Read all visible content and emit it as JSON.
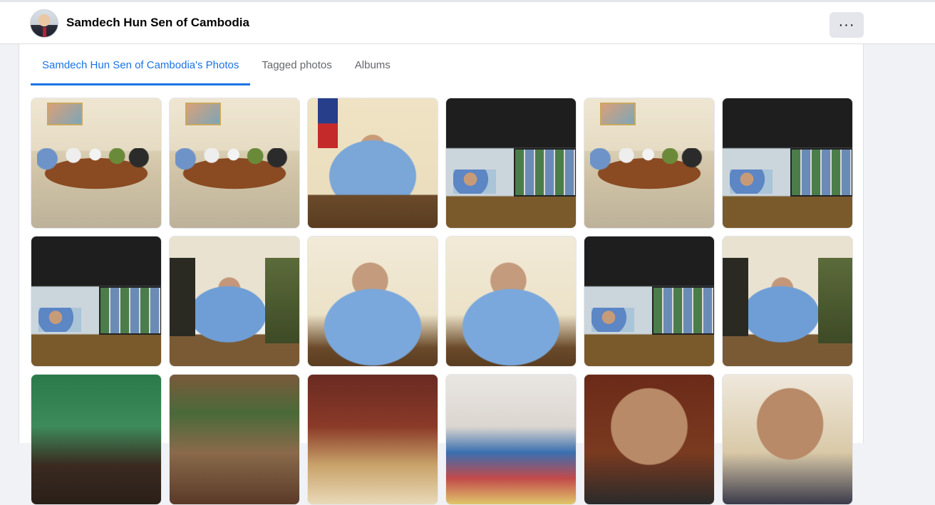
{
  "header": {
    "page_name": "Samdech Hun Sen of Cambodia",
    "more_label": "···"
  },
  "tabs": [
    {
      "label": "Samdech Hun Sen of Cambodia's Photos",
      "active": true
    },
    {
      "label": "Tagged photos",
      "active": false
    },
    {
      "label": "Albums",
      "active": false
    }
  ],
  "photos": [
    {
      "scene": "meeting room"
    },
    {
      "scene": "meeting room"
    },
    {
      "scene": "man at desk"
    },
    {
      "scene": "video conference screen"
    },
    {
      "scene": "meeting room"
    },
    {
      "scene": "video conference screen"
    },
    {
      "scene": "video conference screen"
    },
    {
      "scene": "map briefing"
    },
    {
      "scene": "phone call"
    },
    {
      "scene": "phone call"
    },
    {
      "scene": "video conference screen"
    },
    {
      "scene": "map briefing"
    },
    {
      "scene": "group session"
    },
    {
      "scene": "conference hall"
    },
    {
      "scene": "conference hall"
    },
    {
      "scene": "event hall"
    },
    {
      "scene": "portrait"
    },
    {
      "scene": "portrait"
    }
  ]
}
